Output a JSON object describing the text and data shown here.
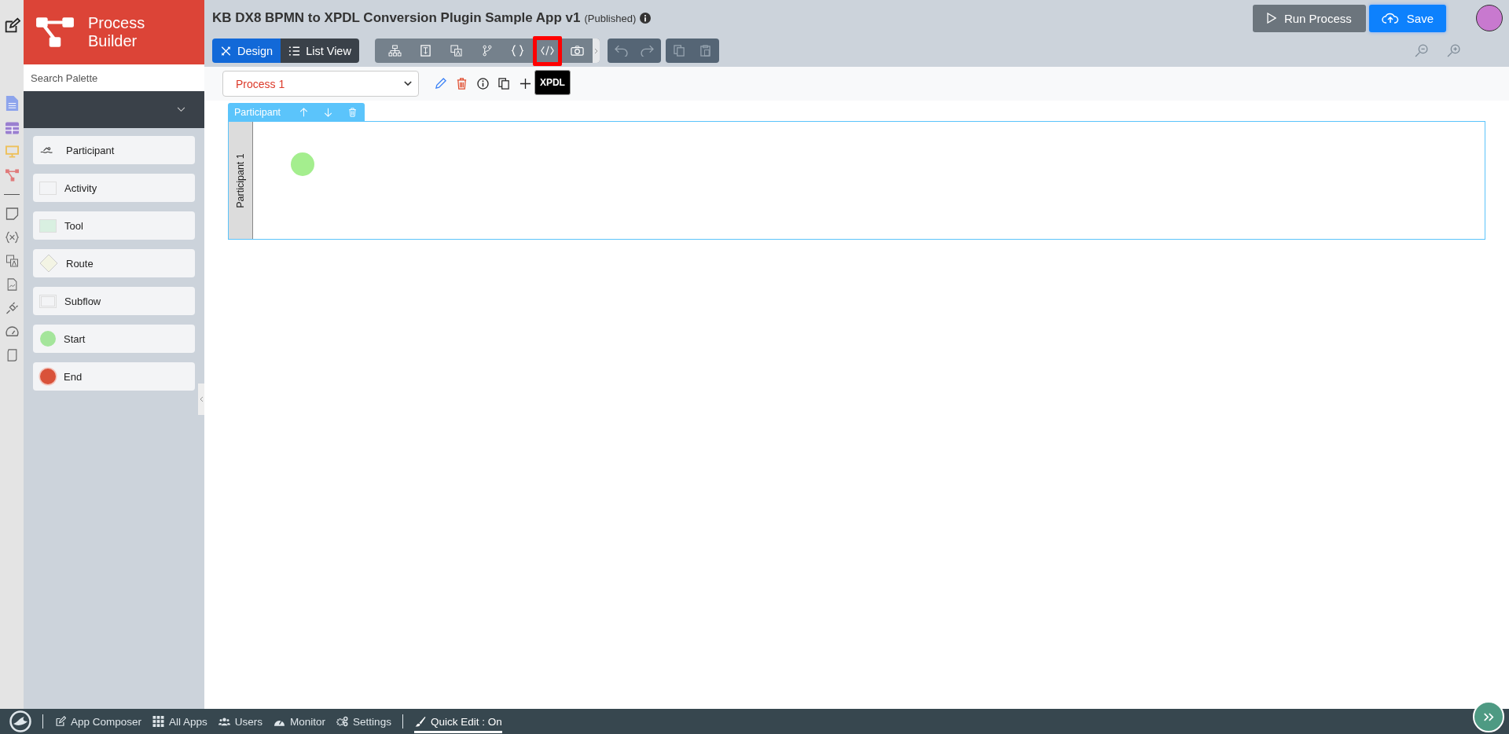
{
  "app": {
    "title": "KB DX8 BPMN to XPDL Conversion Plugin Sample App v1",
    "status": "(Published)"
  },
  "brand": {
    "name": "Process Builder"
  },
  "palette": {
    "search": {
      "placeholder": "Search Palette"
    },
    "items": [
      {
        "kind": "participant",
        "label": "Participant"
      },
      {
        "kind": "activity",
        "label": "Activity"
      },
      {
        "kind": "tool",
        "label": "Tool"
      },
      {
        "kind": "route",
        "label": "Route"
      },
      {
        "kind": "subflow",
        "label": "Subflow"
      },
      {
        "kind": "start",
        "label": "Start"
      },
      {
        "kind": "end",
        "label": "End"
      }
    ]
  },
  "view_tabs": [
    {
      "kind": "design",
      "label": "Design",
      "selected": true
    },
    {
      "kind": "list",
      "label": "List View",
      "selected": false
    }
  ],
  "tools": [
    {
      "kind": "hierarchy",
      "highlighted": false
    },
    {
      "kind": "form",
      "highlighted": false
    },
    {
      "kind": "translate",
      "highlighted": false
    },
    {
      "kind": "branch",
      "highlighted": false
    },
    {
      "kind": "braces",
      "highlighted": false
    },
    {
      "kind": "code",
      "highlighted": true
    },
    {
      "kind": "camera",
      "highlighted": false
    }
  ],
  "tooltip": "XPDL",
  "actions": {
    "run": "Run Process",
    "save": "Save"
  },
  "process_select": {
    "value": "Process 1"
  },
  "participant_bar": {
    "label": "Participant"
  },
  "lanes": [
    {
      "label": "Participant 1",
      "nodes": [
        {
          "kind": "start"
        }
      ]
    }
  ],
  "footer": [
    {
      "kind": "edit",
      "label": "App Composer"
    },
    {
      "kind": "apps",
      "label": "All Apps"
    },
    {
      "kind": "users",
      "label": "Users"
    },
    {
      "kind": "monitor",
      "label": "Monitor"
    },
    {
      "kind": "settings",
      "label": "Settings"
    },
    {
      "kind": "brush",
      "label": "Quick Edit : On"
    }
  ]
}
